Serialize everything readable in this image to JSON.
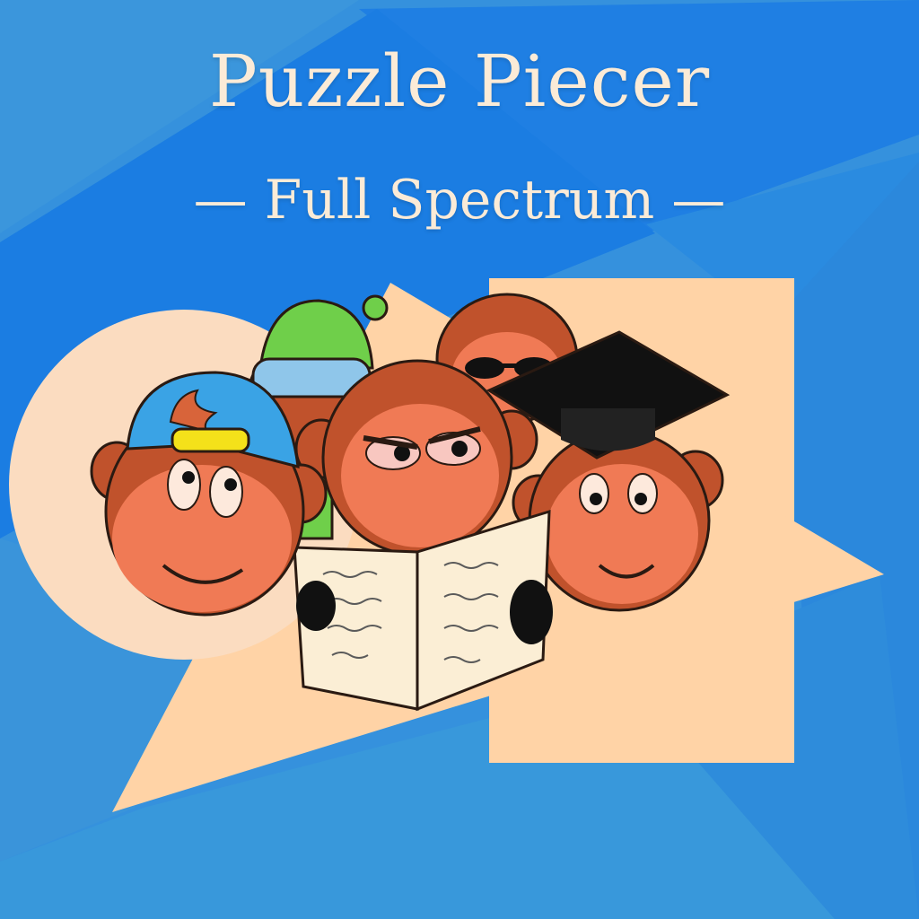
{
  "title": "Puzzle Piecer",
  "subtitle": "— Full Spectrum —",
  "colors": {
    "background_blue": "#2f8fdc",
    "title_cream": "#fbebd7",
    "shape_peach": "#ffd3a6",
    "monkey_fur": "#c0522c",
    "monkey_face": "#f07a55"
  },
  "illustration": {
    "subject": "monkey-group-icon",
    "accessories": [
      "baseball-cap-icon",
      "beanie-goggles-icon",
      "sunglasses-icon",
      "graduation-cap-icon",
      "newspaper-icon"
    ]
  }
}
